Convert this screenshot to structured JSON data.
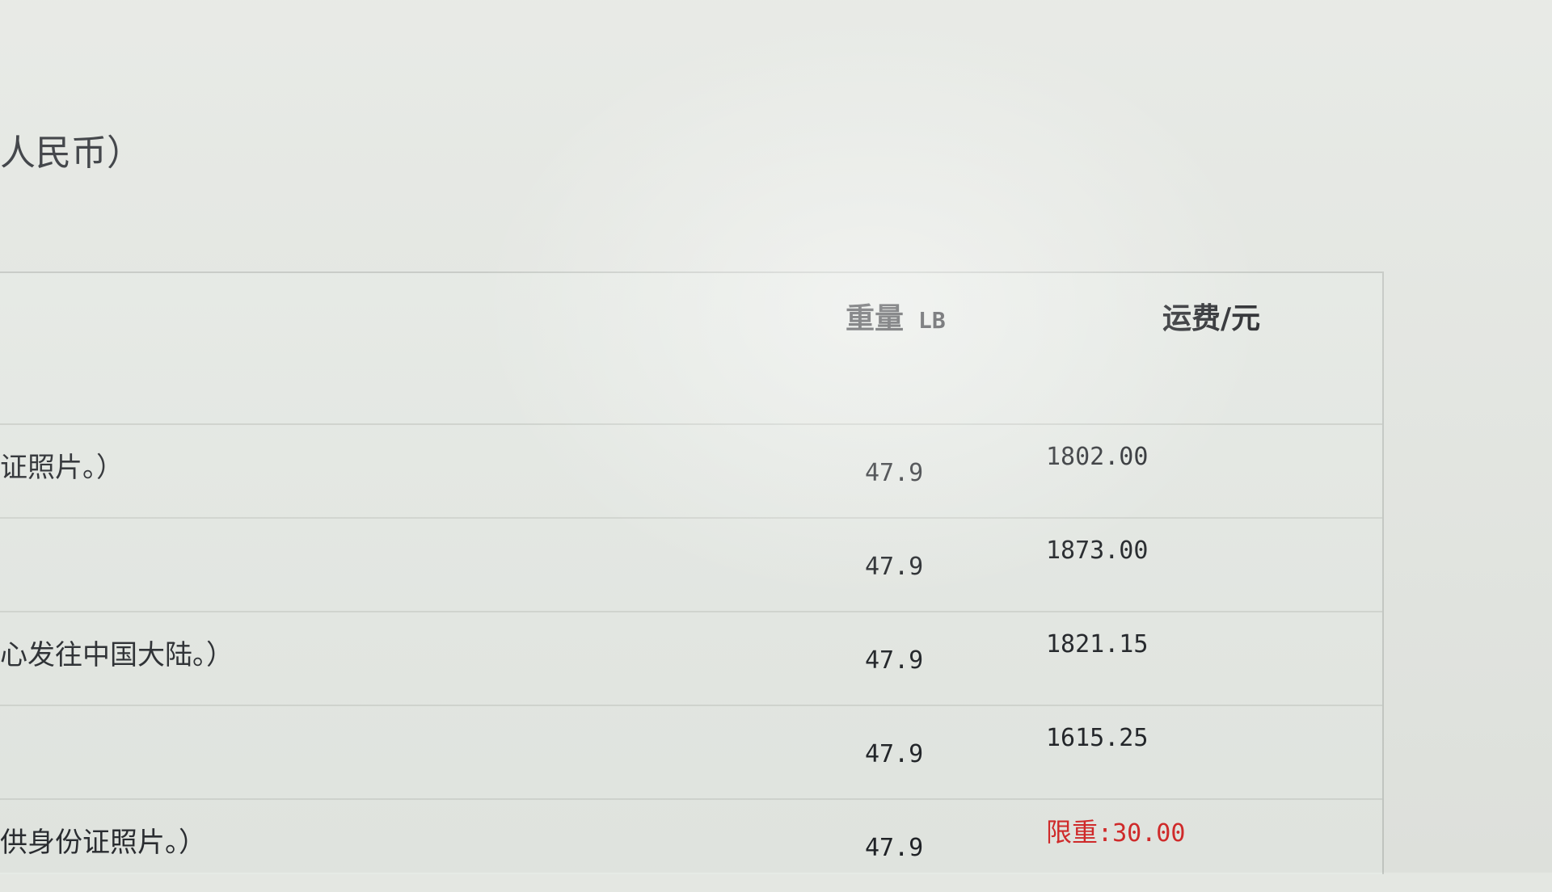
{
  "heading": {
    "currency_note": "人民币）"
  },
  "table": {
    "headers": {
      "weight": "重量",
      "weight_unit": "LB",
      "fee": "运费/元"
    },
    "rows": [
      {
        "desc": "证照片。）",
        "weight": "47.9",
        "fee": "1802.00"
      },
      {
        "desc": "",
        "weight": "47.9",
        "fee": "1873.00"
      },
      {
        "desc": "心发往中国大陆。）",
        "weight": "47.9",
        "fee": "1821.15"
      },
      {
        "desc": "",
        "weight": "47.9",
        "fee": "1615.25"
      },
      {
        "desc": "供身份证照片。）",
        "weight": "47.9",
        "limit_label": "限重",
        "limit_value": ":30.00"
      }
    ]
  },
  "colors": {
    "limit_text": "#d52a2a",
    "background": "#e4e7e2"
  }
}
